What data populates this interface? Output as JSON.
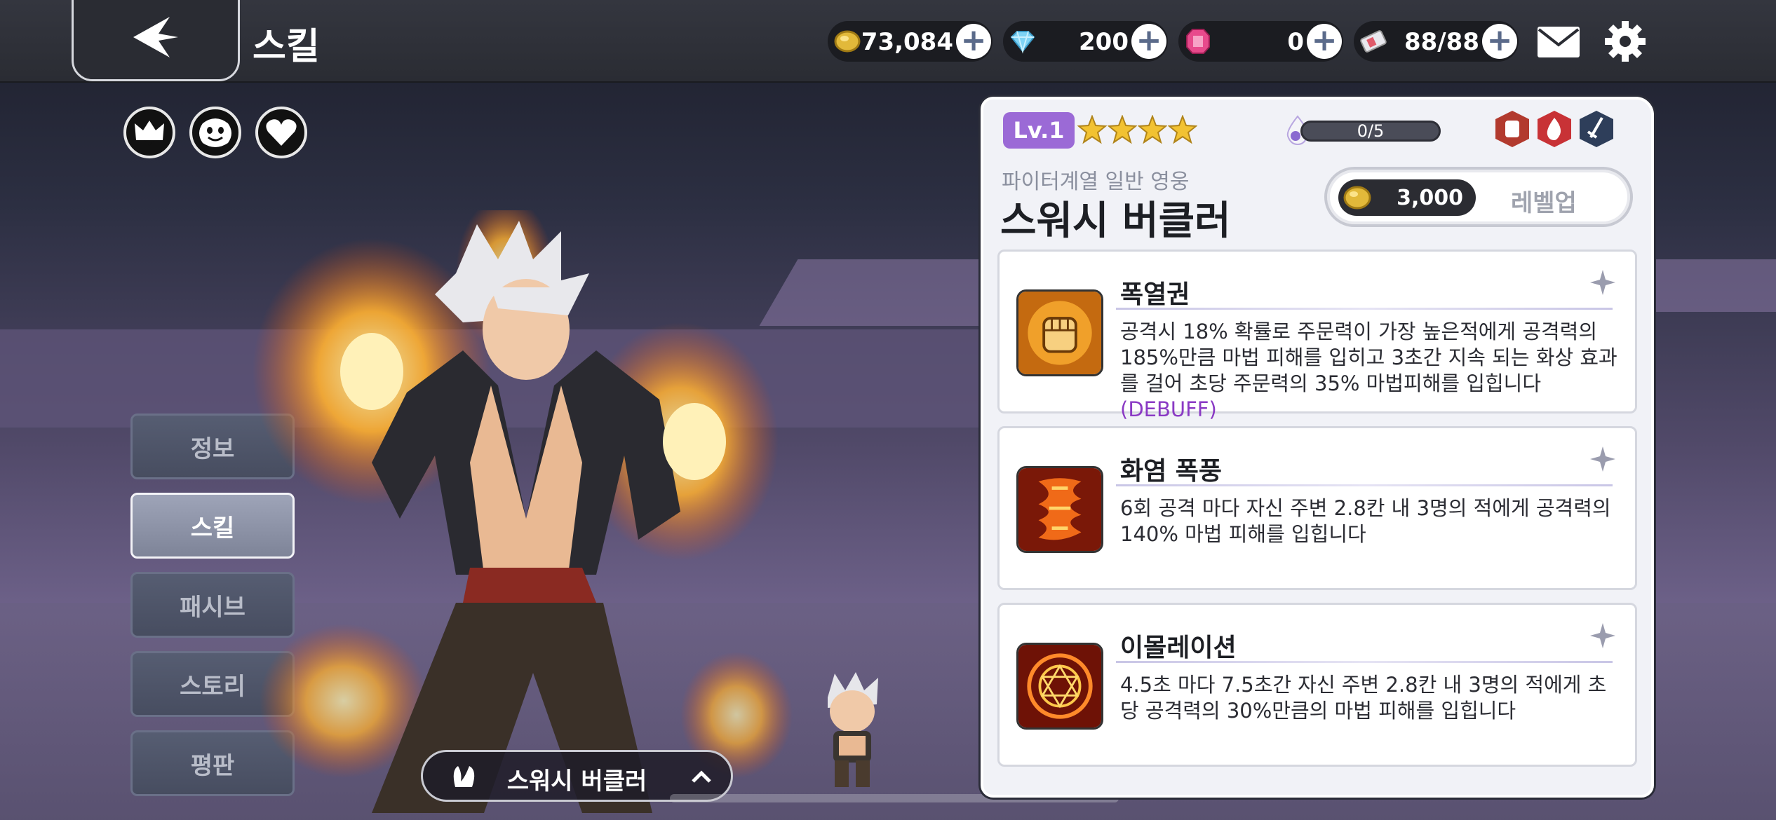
{
  "header": {
    "title": "스킬",
    "resources": [
      {
        "name": "gold",
        "value": "73,084"
      },
      {
        "name": "diamond",
        "value": "200"
      },
      {
        "name": "ruby",
        "value": "0"
      },
      {
        "name": "ticket",
        "value": "88/88"
      }
    ]
  },
  "side_menu": [
    {
      "label": "정보",
      "active": false
    },
    {
      "label": "스킬",
      "active": true
    },
    {
      "label": "패시브",
      "active": false
    },
    {
      "label": "스토리",
      "active": false
    },
    {
      "label": "평판",
      "active": false
    }
  ],
  "hero_bar": {
    "name": "스워시 버클러"
  },
  "panel": {
    "level": "Lv.1",
    "stars": 4,
    "gauge_text": "0/5",
    "subtitle": "파이터계열 일반 영웅",
    "hero_name": "스워시 버클러",
    "levelup_cost": "3,000",
    "levelup_label": "레벨업"
  },
  "skills": [
    {
      "title": "폭열권",
      "desc": "공격시 18% 확률로 주문력이 가장 높은적에게 공격력의 185%만큼 마법 피해를 입히고 3초간 지속 되는 화상 효과를 걸어 초당 주문력의 35% 마법피해를 입힙니다",
      "tag": "(DEBUFF)"
    },
    {
      "title": "화염 폭풍",
      "desc": "6회 공격 마다 자신 주변 2.8칸 내 3명의 적에게 공격력의 140% 마법 피해를 입힙니다",
      "tag": ""
    },
    {
      "title": "이몰레이션",
      "desc": "4.5초 마다 7.5초간 자신 주변 2.8칸 내 3명의 적에게 초당 공격력의 30%만큼의 마법 피해를 입힙니다",
      "tag": ""
    }
  ],
  "colors": {
    "level_badge": "#9b6ad6",
    "debuff": "#8a3ac4",
    "panel_bg": "#f1f2f7"
  }
}
